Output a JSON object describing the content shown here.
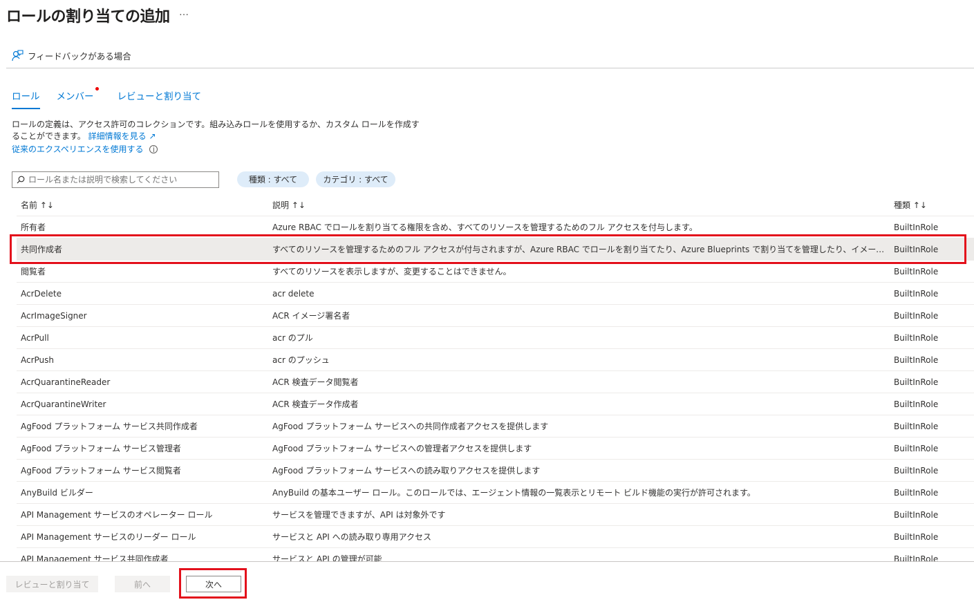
{
  "header": {
    "title": "ロールの割り当ての追加",
    "more": "…",
    "feedback": "フィードバックがある場合"
  },
  "tabs": [
    {
      "label": "ロール"
    },
    {
      "label": "メンバー"
    },
    {
      "label": "レビューと割り当て"
    }
  ],
  "intro": {
    "text": "ロールの定義は、アクセス許可のコレクションです。組み込みロールを使用するか、カスタム ロールを作成することができます。",
    "link": "詳細情報を見る",
    "legacy": "従来のエクスペリエンスを使用する"
  },
  "filters": {
    "search_placeholder": "ロール名または説明で検索してください",
    "type": "種類 : すべて",
    "category": "カテゴリ : すべて"
  },
  "columns": {
    "name": "名前 ↑↓",
    "desc": "説明 ↑↓",
    "type": "種類 ↑↓"
  },
  "rows": [
    {
      "name": "所有者",
      "desc": "Azure RBAC でロールを割り当てる権限を含め、すべてのリソースを管理するためのフル アクセスを付与します。",
      "type": "BuiltInRole"
    },
    {
      "name": "共同作成者",
      "desc": "すべてのリソースを管理するためのフル アクセスが付与されますが、Azure RBAC でロールを割り当てたり、Azure Blueprints で割り当てを管理したり、イメージ ギャラリーを共有し...",
      "type": "BuiltInRole"
    },
    {
      "name": "閲覧者",
      "desc": "すべてのリソースを表示しますが、変更することはできません。",
      "type": "BuiltInRole"
    },
    {
      "name": "AcrDelete",
      "desc": "acr delete",
      "type": "BuiltInRole"
    },
    {
      "name": "AcrImageSigner",
      "desc": "ACR イメージ署名者",
      "type": "BuiltInRole"
    },
    {
      "name": "AcrPull",
      "desc": "acr のプル",
      "type": "BuiltInRole"
    },
    {
      "name": "AcrPush",
      "desc": "acr のプッシュ",
      "type": "BuiltInRole"
    },
    {
      "name": "AcrQuarantineReader",
      "desc": "ACR 検査データ閲覧者",
      "type": "BuiltInRole"
    },
    {
      "name": "AcrQuarantineWriter",
      "desc": "ACR 検査データ作成者",
      "type": "BuiltInRole"
    },
    {
      "name": "AgFood プラットフォーム サービス共同作成者",
      "desc": "AgFood プラットフォーム サービスへの共同作成者アクセスを提供します",
      "type": "BuiltInRole"
    },
    {
      "name": "AgFood プラットフォーム サービス管理者",
      "desc": "AgFood プラットフォーム サービスへの管理者アクセスを提供します",
      "type": "BuiltInRole"
    },
    {
      "name": "AgFood プラットフォーム サービス閲覧者",
      "desc": "AgFood プラットフォーム サービスへの読み取りアクセスを提供します",
      "type": "BuiltInRole"
    },
    {
      "name": "AnyBuild ビルダー",
      "desc": "AnyBuild の基本ユーザー ロール。このロールでは、エージェント情報の一覧表示とリモート ビルド機能の実行が許可されます。",
      "type": "BuiltInRole"
    },
    {
      "name": "API Management サービスのオペレーター ロール",
      "desc": "サービスを管理できますが、API は対象外です",
      "type": "BuiltInRole"
    },
    {
      "name": "API Management サービスのリーダー ロール",
      "desc": "サービスと API への読み取り専用アクセス",
      "type": "BuiltInRole"
    },
    {
      "name": "API Management サービス共同作成者",
      "desc": "サービスと API の管理が可能",
      "type": "BuiltInRole"
    }
  ],
  "footer": {
    "review": "レビューと割り当て",
    "prev": "前へ",
    "next": "次へ"
  }
}
